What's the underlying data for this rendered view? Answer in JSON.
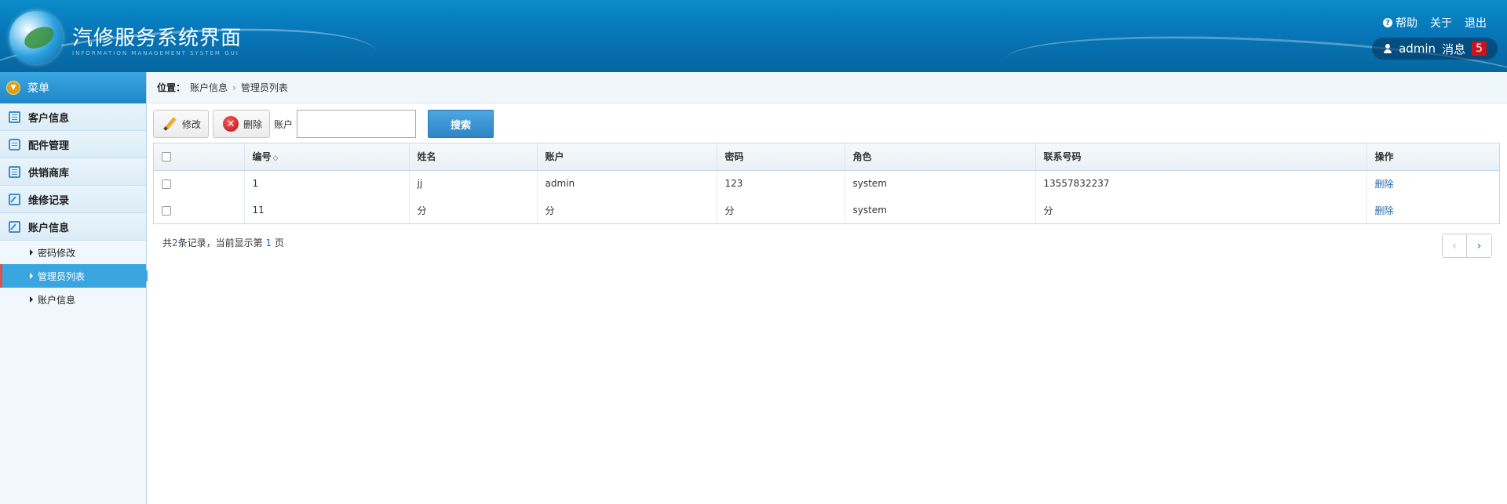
{
  "header": {
    "title": "汽修服务系统界面",
    "subtitle": "INFORMATION MANAGEMENT SYSTEM GUI",
    "links": {
      "help": "帮助",
      "about": "关于",
      "logout": "退出"
    },
    "user": {
      "name": "admin",
      "messages_label": "消息",
      "messages_count": "5"
    }
  },
  "sidebar": {
    "menu_title": "菜单",
    "items": [
      {
        "label": "客户信息",
        "icon": "list-icon"
      },
      {
        "label": "配件管理",
        "icon": "chat-icon"
      },
      {
        "label": "供销商库",
        "icon": "list-icon"
      },
      {
        "label": "维修记录",
        "icon": "edit-icon"
      },
      {
        "label": "账户信息",
        "icon": "edit-icon"
      }
    ],
    "sub_items": [
      {
        "label": "密码修改",
        "active": false
      },
      {
        "label": "管理员列表",
        "active": true
      },
      {
        "label": "账户信息",
        "active": false
      }
    ]
  },
  "breadcrumb": {
    "label": "位置：",
    "parent": "账户信息",
    "current": "管理员列表"
  },
  "toolbar": {
    "edit_label": "修改",
    "delete_label": "删除",
    "account_label": "账户",
    "search_value": "",
    "search_label": "搜索"
  },
  "table": {
    "columns": [
      "编号",
      "姓名",
      "账户",
      "密码",
      "角色",
      "联系号码",
      "操作"
    ],
    "rows": [
      {
        "id": "1",
        "name": "jj",
        "account": "admin",
        "password": "123",
        "role": "system",
        "phone": "13557832237",
        "action": "删除"
      },
      {
        "id": "11",
        "name": "分",
        "account": "分",
        "password": "分",
        "role": "system",
        "phone": "分",
        "action": "删除"
      }
    ]
  },
  "pager": {
    "prefix": "共",
    "count": "2",
    "middle": "条记录，当前显示第",
    "page": "1",
    "suffix": "页"
  },
  "colors": {
    "header_blue": "#0776b8",
    "accent_blue": "#3aa6e0",
    "badge_red": "#c9151e"
  }
}
